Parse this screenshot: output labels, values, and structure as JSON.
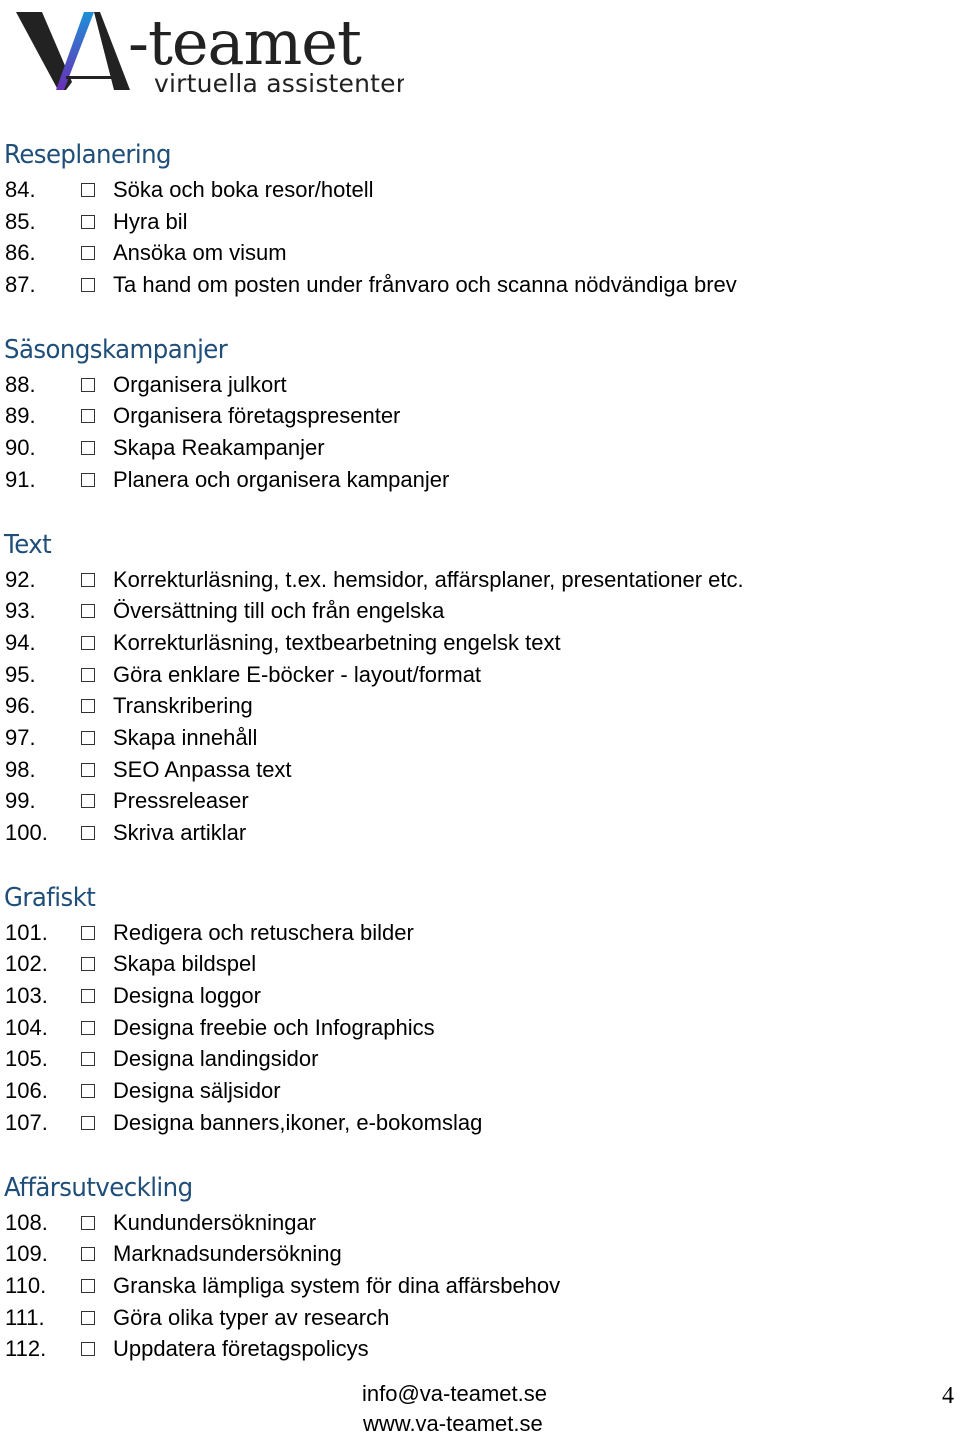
{
  "logo": {
    "primary": "VA-teamet",
    "tagline": "virtuella assistenter",
    "gradient_start": "#1e8fd8",
    "gradient_end": "#6a2fb5"
  },
  "colors": {
    "heading": "#1f4e79",
    "text": "#000000"
  },
  "sections": [
    {
      "title": "Reseplanering",
      "items": [
        {
          "num": "84.",
          "label": "Söka och boka resor/hotell",
          "checked": false
        },
        {
          "num": "85.",
          "label": "Hyra bil",
          "checked": false
        },
        {
          "num": "86.",
          "label": "Ansöka om visum",
          "checked": false
        },
        {
          "num": "87.",
          "label": "Ta hand om posten under frånvaro och scanna nödvändiga brev",
          "checked": false
        }
      ]
    },
    {
      "title": "Säsongskampanjer",
      "items": [
        {
          "num": "88.",
          "label": "Organisera julkort",
          "checked": false
        },
        {
          "num": "89.",
          "label": "Organisera företagspresenter",
          "checked": false
        },
        {
          "num": "90.",
          "label": "Skapa Reakampanjer",
          "checked": false
        },
        {
          "num": "91.",
          "label": "Planera och organisera kampanjer",
          "checked": false
        }
      ]
    },
    {
      "title": "Text",
      "items": [
        {
          "num": "92.",
          "label": "Korrekturläsning, t.ex. hemsidor, affärsplaner, presentationer etc.",
          "checked": false
        },
        {
          "num": "93.",
          "label": "Översättning till och från engelska",
          "checked": false
        },
        {
          "num": "94.",
          "label": "Korrekturläsning, textbearbetning engelsk text",
          "checked": false
        },
        {
          "num": "95.",
          "label": "Göra enklare E-böcker - layout/format",
          "checked": false
        },
        {
          "num": "96.",
          "label": "Transkribering",
          "checked": false
        },
        {
          "num": "97.",
          "label": "Skapa innehåll",
          "checked": false
        },
        {
          "num": "98.",
          "label": "SEO Anpassa text",
          "checked": false
        },
        {
          "num": "99.",
          "label": "Pressreleaser",
          "checked": false
        },
        {
          "num": "100.",
          "label": "Skriva artiklar",
          "checked": false
        }
      ]
    },
    {
      "title": "Grafiskt",
      "items": [
        {
          "num": "101.",
          "label": "Redigera och retuschera bilder",
          "checked": false
        },
        {
          "num": "102.",
          "label": "Skapa bildspel",
          "checked": false
        },
        {
          "num": "103.",
          "label": "Designa loggor",
          "checked": false
        },
        {
          "num": "104.",
          "label": "Designa freebie och Infographics",
          "checked": false
        },
        {
          "num": "105.",
          "label": "Designa landingsidor",
          "checked": false
        },
        {
          "num": "106.",
          "label": "Designa säljsidor",
          "checked": false
        },
        {
          "num": "107.",
          "label": "Designa banners,ikoner, e-bokomslag",
          "checked": false
        }
      ]
    },
    {
      "title": "Affärsutveckling",
      "items": [
        {
          "num": "108.",
          "label": "Kundundersökningar",
          "checked": false
        },
        {
          "num": "109.",
          "label": "Marknadsundersökning",
          "checked": false
        },
        {
          "num": "110.",
          "label": "Granska lämpliga system för dina affärsbehov",
          "checked": false
        },
        {
          "num": "111.",
          "label": "Göra olika typer av research",
          "checked": false
        },
        {
          "num": "112.",
          "label": "Uppdatera företagspolicys",
          "checked": false
        }
      ]
    }
  ],
  "footer": {
    "email": "info@va-teamet.se",
    "website": "www.va-teamet.se",
    "page_number": "4"
  }
}
